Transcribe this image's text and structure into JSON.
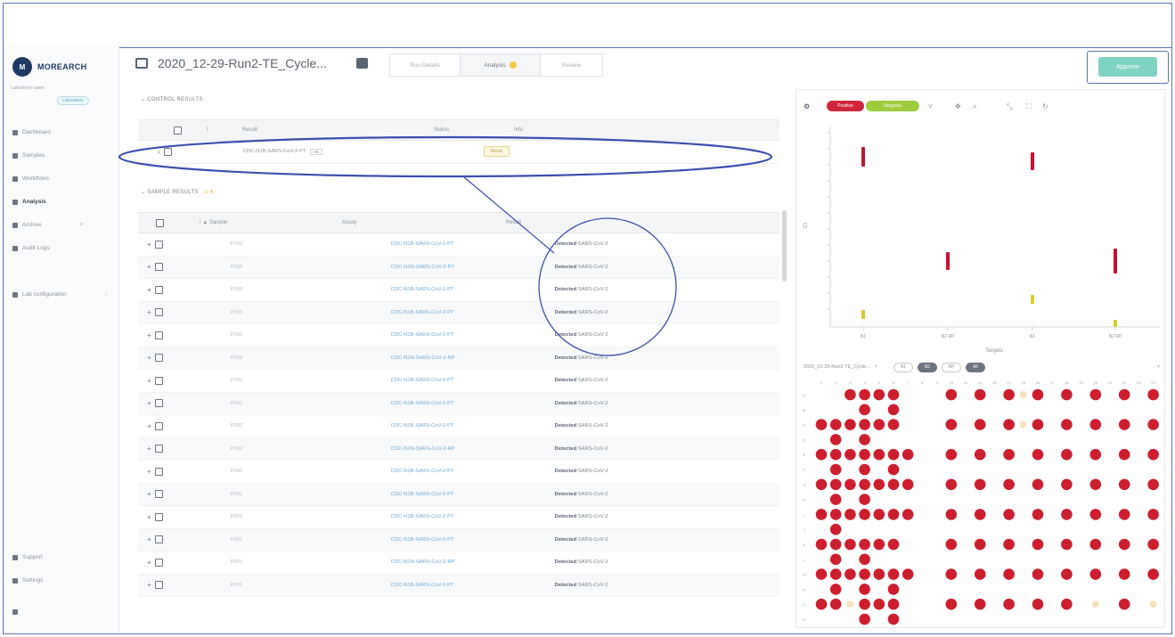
{
  "sidebar": {
    "logo_text": "MOREARCH",
    "logo_sub": "Laboratory name",
    "lab_chip": "Laboratory",
    "nav": [
      {
        "label": "Dashboard",
        "icon": "dashboard-icon"
      },
      {
        "label": "Samples",
        "icon": "samples-icon"
      },
      {
        "label": "Workflows",
        "icon": "workflows-icon"
      },
      {
        "label": "Analysis",
        "icon": "analysis-icon",
        "active": true
      },
      {
        "label": "Archive",
        "icon": "archive-icon",
        "caret": "˅"
      },
      {
        "label": "Audit Logs",
        "icon": "audit-icon"
      },
      {
        "label": "Lab configuration",
        "icon": "config-icon",
        "caret": "›"
      }
    ],
    "bottom": [
      {
        "label": "Support",
        "icon": "support-icon"
      },
      {
        "label": "Settings",
        "icon": "settings-icon"
      },
      {
        "label": "",
        "icon": "user-icon"
      }
    ]
  },
  "header": {
    "run_title": "2020_12-29-Run2-TE_Cycle...",
    "tabs": [
      {
        "label": "Run Details"
      },
      {
        "label": "Analysis",
        "badge": true,
        "active": true
      },
      {
        "label": "Review"
      }
    ],
    "approve_label": "Approve"
  },
  "control": {
    "section_label": "⌄ CONTROL RESULTS",
    "columns": [
      "",
      "!",
      "Result",
      "Status",
      "Info"
    ],
    "rows": [
      {
        "result": "CDC-N1B-SARS-CoV-2-PT",
        "tag": "HB",
        "status": "Rerun"
      }
    ]
  },
  "samples": {
    "section_label": "⌄ SAMPLE RESULTS",
    "warning_count": "⚠ 4",
    "columns": [
      "",
      "! ▲ Sample",
      "Assay",
      "Result"
    ],
    "rows": [
      {
        "sample": "P003",
        "assay": "CDC-N1B-SARS-CoV-2-PT",
        "result_strong": "Detected",
        "result_rest": "SARS-CoV-2"
      },
      {
        "sample": "P003",
        "assay": "CDC-N1N-SARS-CoV-2-PT",
        "result_strong": "Detected",
        "result_rest": "SARS-CoV-2"
      },
      {
        "sample": "P003",
        "assay": "CDC-N1B-SARS-CoV-2-PT",
        "result_strong": "Detected",
        "result_rest": "SARS-CoV-2"
      },
      {
        "sample": "P003",
        "assay": "CDC-N1B-SARS-CoV-2-PT",
        "result_strong": "Detected",
        "result_rest": "SARS-CoV-2"
      },
      {
        "sample": "P003",
        "assay": "CDC-N1B-SARS-CoV-2-PT",
        "result_strong": "Detected",
        "result_rest": "SARS-CoV-2"
      },
      {
        "sample": "P003",
        "assay": "CDC-N1N-SARS-CoV-2-RP",
        "result_strong": "Detected",
        "result_rest": "SARS-CoV-2"
      },
      {
        "sample": "P002",
        "assay": "CDC-N1B-SARS-CoV-2-PT",
        "result_strong": "Detected",
        "result_rest": "SARS-CoV-2"
      },
      {
        "sample": "P002",
        "assay": "CDC-N1B-SARS-CoV-2-PT",
        "result_strong": "Detected",
        "result_rest": "SARS-CoV-2"
      },
      {
        "sample": "P002",
        "assay": "CDC-N1B-SARS-CoV-2-PT",
        "result_strong": "Detected",
        "result_rest": "SARS-CoV-2"
      },
      {
        "sample": "P002",
        "assay": "CDC-N1N-SARS-CoV-2-RP",
        "result_strong": "Detected",
        "result_rest": "SARS-CoV-2"
      },
      {
        "sample": "P002",
        "assay": "CDC-N1B-SARS-CoV-2-PT",
        "result_strong": "Detected",
        "result_rest": "SARS-CoV-2"
      },
      {
        "sample": "P002",
        "assay": "CDC-N1B-SARS-CoV-2-PT",
        "result_strong": "Detected",
        "result_rest": "SARS-CoV-2"
      },
      {
        "sample": "P001",
        "assay": "CDC-N1B-SARS-CoV-2-PT",
        "result_strong": "Detected",
        "result_rest": "SARS-CoV-2"
      },
      {
        "sample": "P001",
        "assay": "CDC-N1B-SARS-CoV-2-PT",
        "result_strong": "Detected",
        "result_rest": "SARS-CoV-2"
      },
      {
        "sample": "P001",
        "assay": "CDC-N1N-SARS-CoV-2-RP",
        "result_strong": "Detected",
        "result_rest": "SARS-CoV-2"
      },
      {
        "sample": "P001",
        "assay": "CDC-N1B-SARS-CoV-2-PT",
        "result_strong": "Detected",
        "result_rest": "SARS-CoV-2"
      }
    ]
  },
  "chart": {
    "legend": [
      {
        "label": "Positive",
        "color": "#d0253a"
      },
      {
        "label": "Negative",
        "color": "#9ccc3c"
      }
    ],
    "ylabel": "Ct",
    "xlabel": "Targets",
    "x_ticks": [
      "N1",
      "N2 RP",
      "N1",
      "N2 RP"
    ],
    "colors": {
      "red": "#c8102e",
      "yellow": "#d4cc2a"
    }
  },
  "plate": {
    "selector_label": "2020_12-29-Run2-TE_Cycle...",
    "chips": [
      "N1",
      "N2",
      "RP",
      "All"
    ],
    "colors": {
      "filled": "#cc1e2e",
      "light": "#f4e2c2"
    },
    "cols": [
      "1",
      "2",
      "3",
      "4",
      "5",
      "6",
      "7",
      "8",
      "9",
      "10",
      "11",
      "12",
      "13",
      "14",
      "15",
      "16",
      "17",
      "18",
      "19",
      "20",
      "21",
      "22",
      "23",
      "24"
    ],
    "rows": [
      "A",
      "B",
      "C",
      "D",
      "E",
      "F",
      "G",
      "H",
      "I",
      "J",
      "K",
      "L",
      "M",
      "N",
      "O",
      "P"
    ]
  }
}
